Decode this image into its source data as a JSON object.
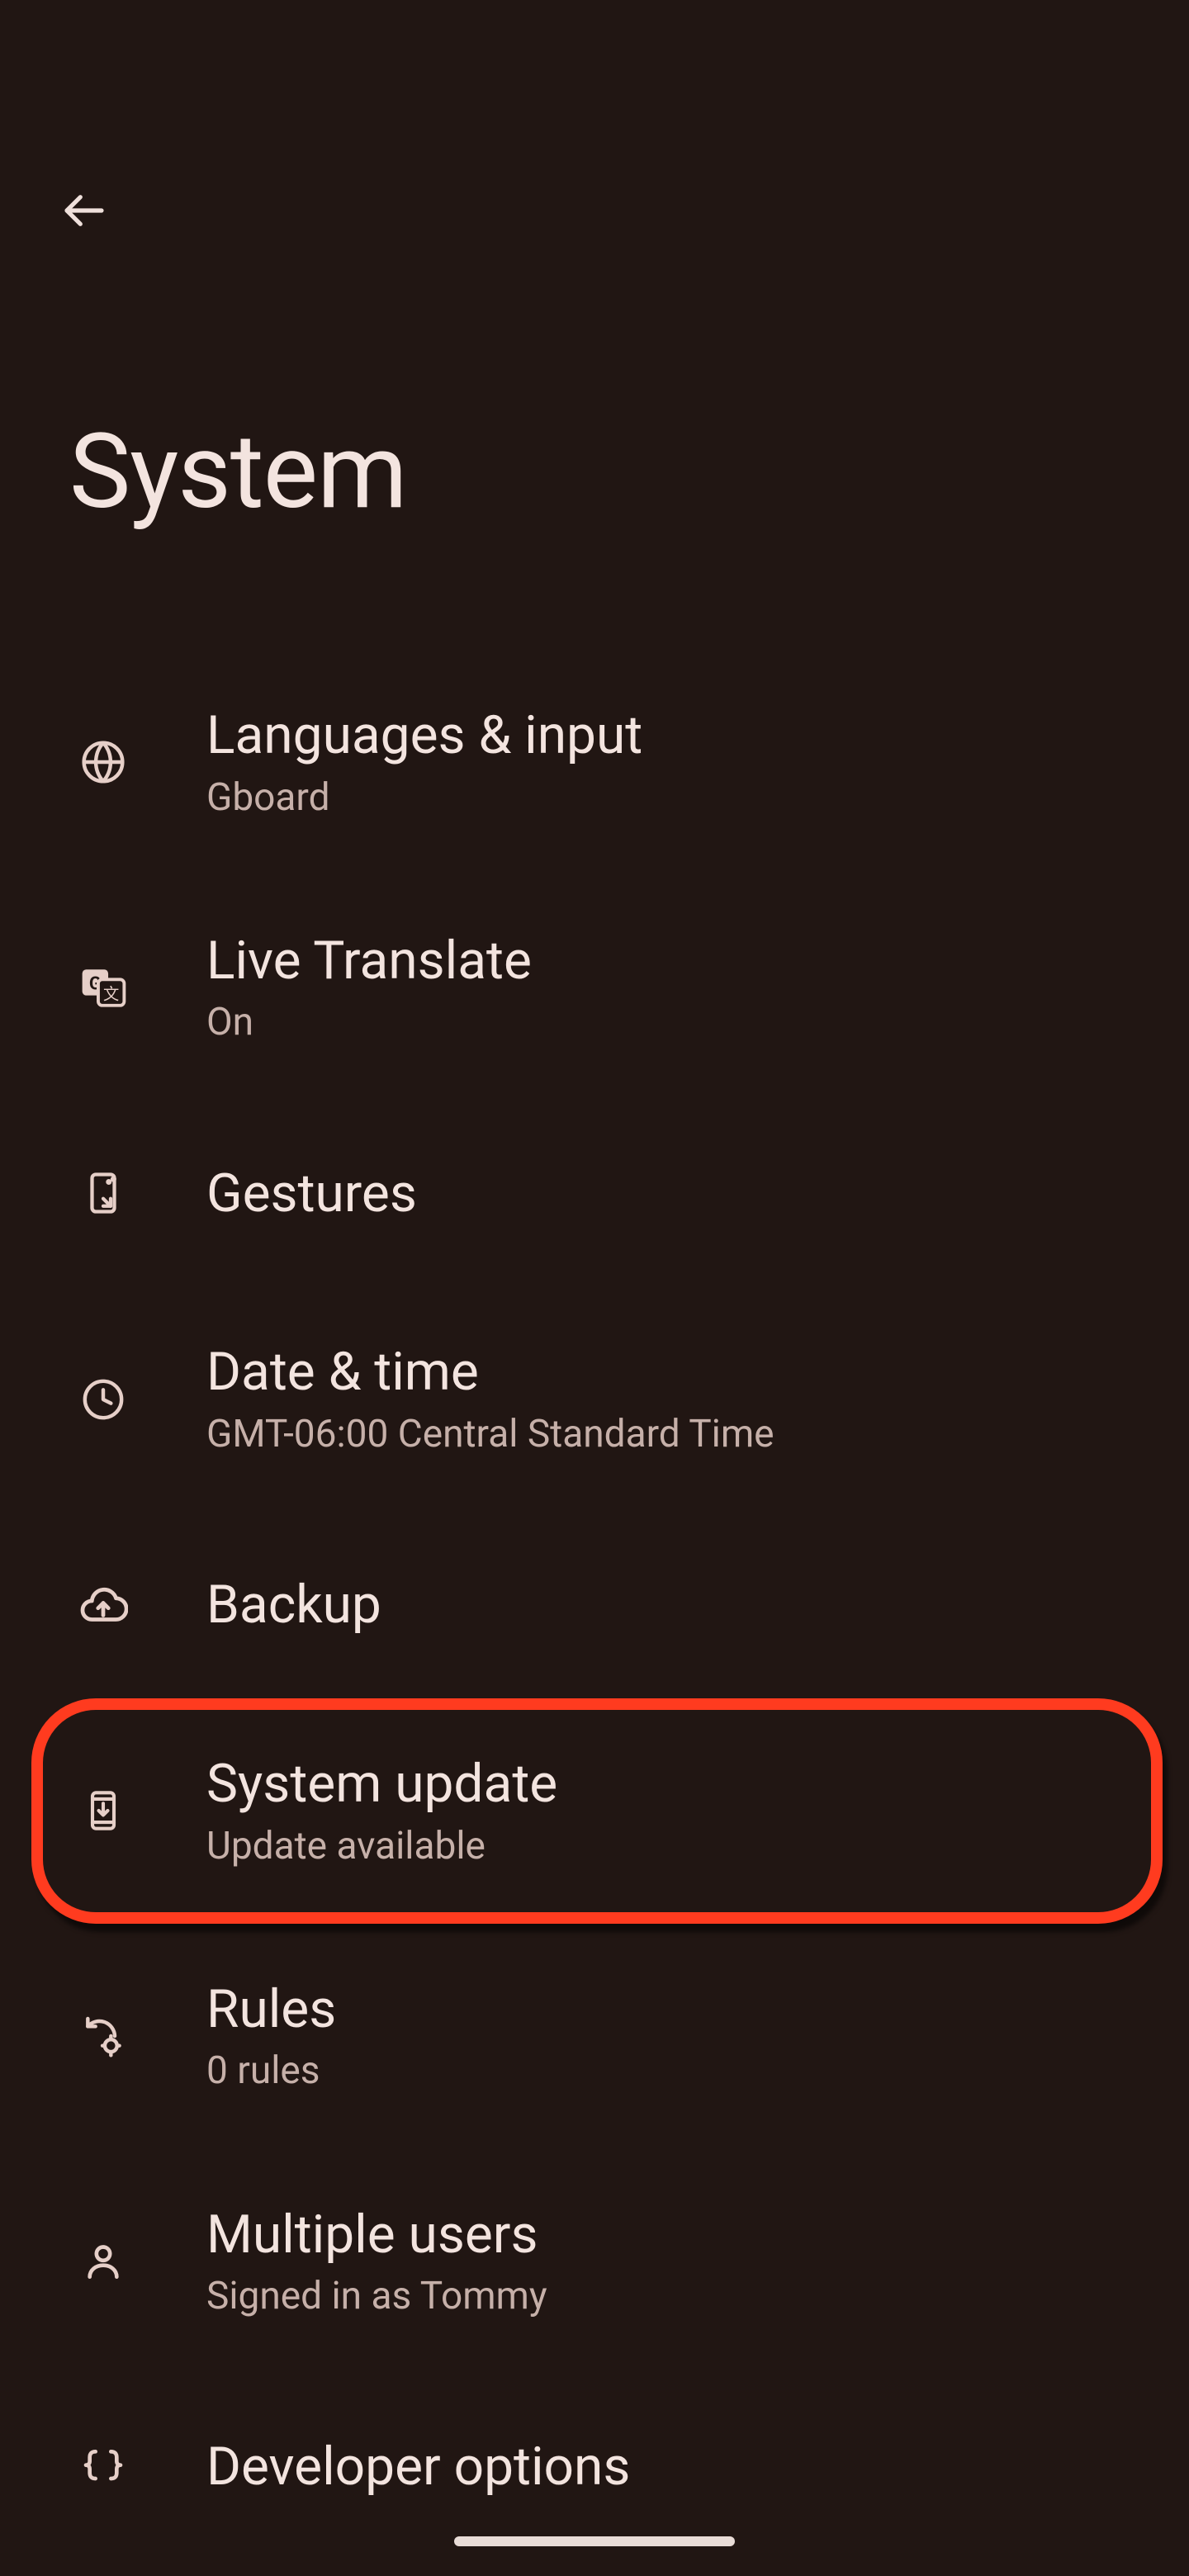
{
  "header": {
    "title": "System"
  },
  "items": [
    {
      "title": "Languages & input",
      "subtitle": "Gboard"
    },
    {
      "title": "Live Translate",
      "subtitle": "On"
    },
    {
      "title": "Gestures",
      "subtitle": ""
    },
    {
      "title": "Date & time",
      "subtitle": "GMT-06:00 Central Standard Time"
    },
    {
      "title": "Backup",
      "subtitle": ""
    },
    {
      "title": "System update",
      "subtitle": "Update available"
    },
    {
      "title": "Rules",
      "subtitle": "0 rules"
    },
    {
      "title": "Multiple users",
      "subtitle": "Signed in as Tommy"
    },
    {
      "title": "Developer options",
      "subtitle": ""
    }
  ],
  "highlight_index": 5
}
